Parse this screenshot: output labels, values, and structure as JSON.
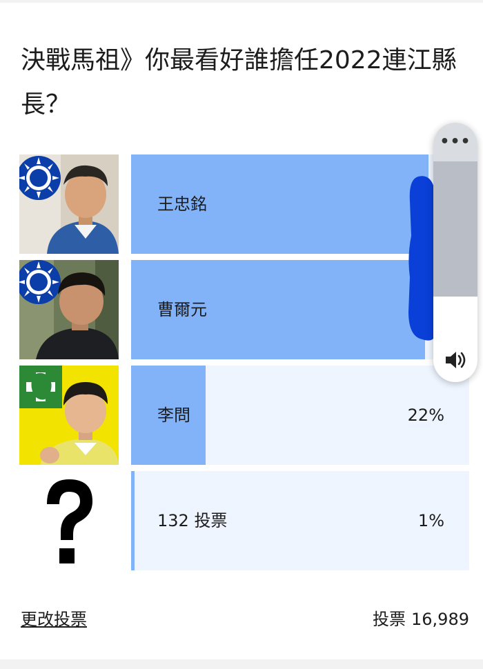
{
  "poll": {
    "title": "決戰馬祖》你最看好誰擔任2022連江縣長？",
    "options": [
      {
        "label": "王忠銘",
        "percent_text": "",
        "share": 0.88
      },
      {
        "label": "曹爾元",
        "percent_text": "",
        "share": 0.87
      },
      {
        "label": "李問",
        "percent_text": "22%",
        "share": 0.22
      },
      {
        "label": "132 投票",
        "percent_text": "1%",
        "share": 0.01
      }
    ],
    "change_vote_label": "更改投票",
    "total_label": "投票",
    "total_value": "16,989"
  },
  "icons": {
    "kmt_emblem": "kmt-party-emblem",
    "dpp_emblem": "dpp-party-emblem",
    "question_mark": "question-mark-icon",
    "more": "more-dots-icon",
    "speaker": "speaker-icon"
  },
  "colors": {
    "bar_fill": "#82b3f9",
    "bar_bg": "#eef5fe",
    "kmt_blue": "#0b3ea8",
    "dpp_green": "#2c8a37",
    "dpp_yellow": "#f3e300",
    "scribble": "#0a3fd8"
  },
  "volume_overlay": {
    "more_label": "•••",
    "level": 0.55
  }
}
